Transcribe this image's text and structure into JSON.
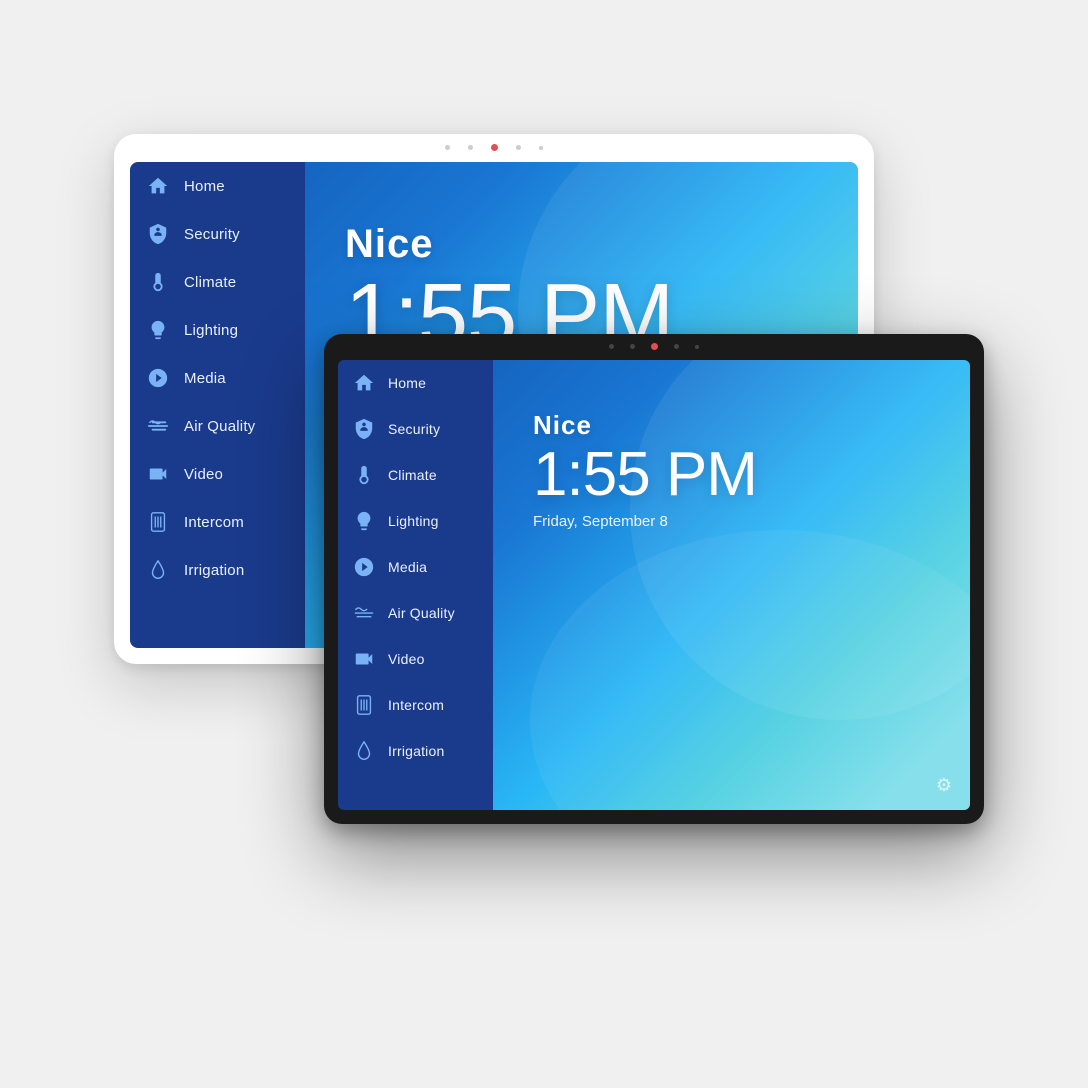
{
  "white_tablet": {
    "brand": "Nice",
    "time": "1:55 PM",
    "camera_dots": [
      "dot",
      "cam",
      "dot",
      "dot"
    ],
    "nav_items": [
      {
        "id": "home",
        "label": "Home"
      },
      {
        "id": "security",
        "label": "Security"
      },
      {
        "id": "climate",
        "label": "Climate"
      },
      {
        "id": "lighting",
        "label": "Lighting"
      },
      {
        "id": "media",
        "label": "Media"
      },
      {
        "id": "air-quality",
        "label": "Air Quality"
      },
      {
        "id": "video",
        "label": "Video"
      },
      {
        "id": "intercom",
        "label": "Intercom"
      },
      {
        "id": "irrigation",
        "label": "Irrigation"
      }
    ]
  },
  "black_tablet": {
    "brand": "Nice",
    "time": "1:55 PM",
    "date": "Friday, September 8",
    "nav_items": [
      {
        "id": "home",
        "label": "Home"
      },
      {
        "id": "security",
        "label": "Security"
      },
      {
        "id": "climate",
        "label": "Climate"
      },
      {
        "id": "lighting",
        "label": "Lighting"
      },
      {
        "id": "media",
        "label": "Media"
      },
      {
        "id": "air-quality",
        "label": "Air Quality"
      },
      {
        "id": "video",
        "label": "Video"
      },
      {
        "id": "intercom",
        "label": "Intercom"
      },
      {
        "id": "irrigation",
        "label": "Irrigation"
      }
    ],
    "settings_label": "⚙"
  },
  "colors": {
    "sidebar_bg": "#1a3a8c",
    "icon_color": "#7ab3f5",
    "white_frame": "#ffffff",
    "black_frame": "#1a1a1a"
  }
}
